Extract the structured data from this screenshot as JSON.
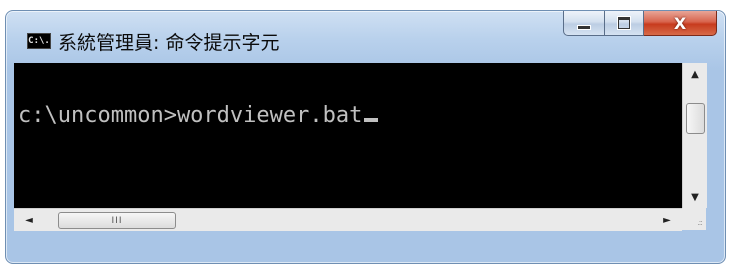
{
  "window": {
    "title": "系統管理員: 命令提示字元",
    "icon": "console-app-icon",
    "icon_text": "C:\\."
  },
  "controls": {
    "minimize": "minimize-icon",
    "maximize": "maximize-icon",
    "close_glyph": "X"
  },
  "console": {
    "prompt_line": "c:\\uncommon>wordviewer.bat"
  },
  "scrollbars": {
    "up": "▲",
    "down": "▼",
    "left": "◄",
    "right": "►",
    "thumb_grip": "III"
  },
  "colors": {
    "console_bg": "#000000",
    "console_fg": "#c0c0c0",
    "close_red": "#c73b1e",
    "frame_blue": "#a9c5e6"
  }
}
